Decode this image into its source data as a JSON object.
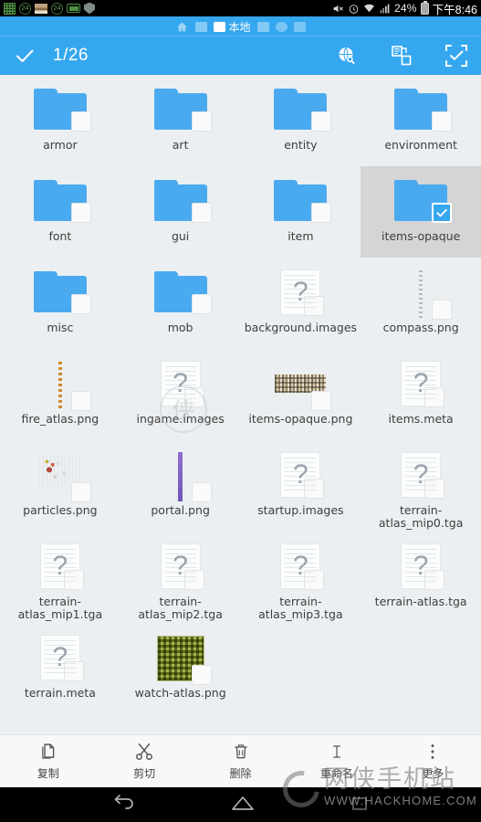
{
  "statusbar": {
    "left_icons": [
      "qr-code-icon",
      "notification-count-icon",
      "image-icon",
      "notification-count-icon-2",
      "battery-saver-icon",
      "shield-icon"
    ],
    "badge_text": "24",
    "badge_text_2": "24",
    "mute_icon": "volume-mute-icon",
    "alarm_icon": "alarm-clock-icon",
    "wifi_icon": "wifi-icon",
    "signal_icon": "cellular-signal-icon",
    "battery_percent": "24%",
    "battery_icon": "battery-icon",
    "time": "下午8:46"
  },
  "tabstrip": {
    "home_icon": "home-icon",
    "active_tab_label": "本地",
    "active_tab_icon": "folder-tab-icon",
    "inactive_tabs": [
      "tab-2",
      "tab-4",
      "tab-5",
      "tab-6"
    ]
  },
  "actionbar": {
    "check_icon": "checkmark-icon",
    "selection_count": "1/26",
    "search_icon": "search-globe-icon",
    "copy_icon": "copy-paste-icon",
    "select_all_icon": "select-all-icon"
  },
  "files": [
    {
      "name": "armor",
      "kind": "folder",
      "selected": false
    },
    {
      "name": "art",
      "kind": "folder",
      "selected": false
    },
    {
      "name": "entity",
      "kind": "folder",
      "selected": false
    },
    {
      "name": "environment",
      "kind": "folder",
      "selected": false
    },
    {
      "name": "font",
      "kind": "folder",
      "selected": false
    },
    {
      "name": "gui",
      "kind": "folder",
      "selected": false
    },
    {
      "name": "item",
      "kind": "folder",
      "selected": false
    },
    {
      "name": "items-opaque",
      "kind": "folder",
      "selected": true
    },
    {
      "name": "misc",
      "kind": "folder",
      "selected": false
    },
    {
      "name": "mob",
      "kind": "folder",
      "selected": false
    },
    {
      "name": "background.images",
      "kind": "unknown",
      "selected": false
    },
    {
      "name": "compass.png",
      "kind": "thumb-compass",
      "selected": false
    },
    {
      "name": "fire_atlas.png",
      "kind": "thumb-fire",
      "selected": false
    },
    {
      "name": "ingame.images",
      "kind": "unknown",
      "selected": false
    },
    {
      "name": "items-opaque.png",
      "kind": "thumb-noise",
      "selected": false
    },
    {
      "name": "items.meta",
      "kind": "unknown",
      "selected": false
    },
    {
      "name": "particles.png",
      "kind": "thumb-particles",
      "selected": false
    },
    {
      "name": "portal.png",
      "kind": "thumb-portal",
      "selected": false
    },
    {
      "name": "startup.images",
      "kind": "unknown",
      "selected": false
    },
    {
      "name": "terrain-atlas_mip0.tga",
      "kind": "unknown",
      "selected": false
    },
    {
      "name": "terrain-atlas_mip1.tga",
      "kind": "unknown",
      "selected": false
    },
    {
      "name": "terrain-atlas_mip2.tga",
      "kind": "unknown",
      "selected": false
    },
    {
      "name": "terrain-atlas_mip3.tga",
      "kind": "unknown",
      "selected": false
    },
    {
      "name": "terrain-atlas.tga",
      "kind": "unknown",
      "selected": false
    },
    {
      "name": "terrain.meta",
      "kind": "unknown",
      "selected": false
    },
    {
      "name": "watch-atlas.png",
      "kind": "thumb-watch",
      "selected": false
    }
  ],
  "bottombar": [
    {
      "label": "复制",
      "icon": "copy-icon"
    },
    {
      "label": "剪切",
      "icon": "scissors-icon"
    },
    {
      "label": "删除",
      "icon": "trash-icon"
    },
    {
      "label": "重命名",
      "icon": "text-cursor-icon"
    },
    {
      "label": "更多",
      "icon": "overflow-menu-icon"
    }
  ],
  "watermark": {
    "site_name": "网侠手机站",
    "url": "WWW.HACKHOME.COM"
  },
  "navbar": {
    "back_icon": "back-arrow-icon",
    "home_icon": "home-button-icon",
    "recents_icon": "recents-icon"
  },
  "colors": {
    "accent": "#35a7ef",
    "folder": "#4aaaf0",
    "grid_bg": "#eceff1",
    "selected_bg": "#d5d5d5"
  }
}
